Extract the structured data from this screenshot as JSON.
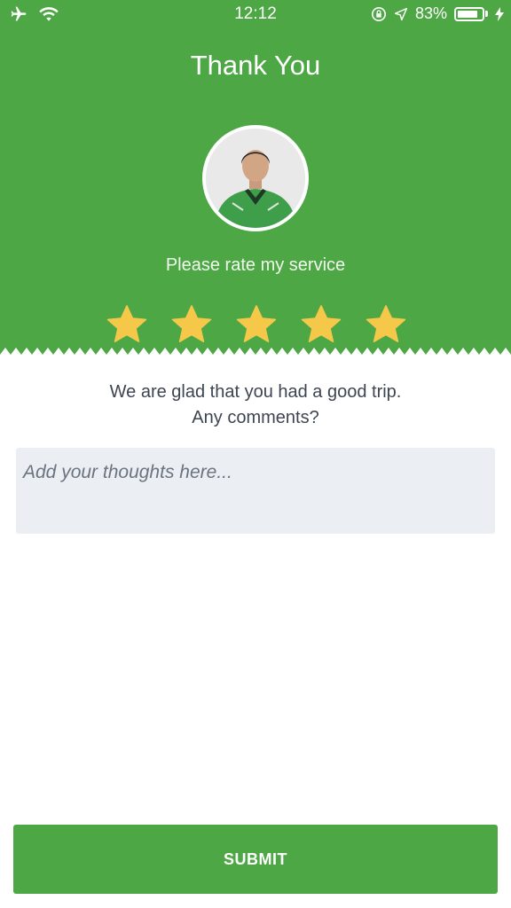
{
  "status_bar": {
    "time": "12:12",
    "battery": "83%",
    "battery_level": 0.83,
    "icons": [
      "airplane-icon",
      "wifi-icon",
      "orientation-lock-icon",
      "location-arrow-icon",
      "battery-icon",
      "charging-icon"
    ]
  },
  "header": {
    "title": "Thank You",
    "rate_prompt": "Please rate my service",
    "rating": 5,
    "max_rating": 5
  },
  "feedback": {
    "message_line1": "We are glad that you had a good trip.",
    "message_line2": "Any comments?",
    "placeholder": "Add your thoughts here...",
    "value": ""
  },
  "actions": {
    "submit_label": "SUBMIT"
  },
  "colors": {
    "brand_green": "#4ea745",
    "star_yellow": "#f5c84a",
    "input_bg": "#ebeef2",
    "text_dark": "#3e4552"
  }
}
